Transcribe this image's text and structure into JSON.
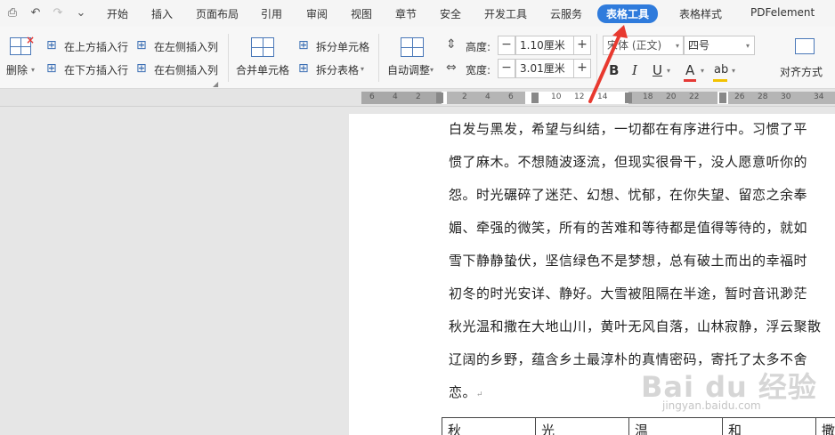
{
  "quick_access": {
    "items": [
      "preview-icon",
      "undo-icon",
      "redo-icon",
      "more-icon"
    ]
  },
  "menu": {
    "tabs": [
      "开始",
      "插入",
      "页面布局",
      "引用",
      "审阅",
      "视图",
      "章节",
      "安全",
      "开发工具",
      "云服务",
      "表格工具",
      "表格样式",
      "PDFelement"
    ],
    "active": "表格工具"
  },
  "ribbon": {
    "delete_label": "删除",
    "insert_above": "在上方插入行",
    "insert_below": "在下方插入行",
    "insert_left": "在左侧插入列",
    "insert_right": "在右侧插入列",
    "merge_cells": "合并单元格",
    "split_cells": "拆分单元格",
    "split_table": "拆分表格",
    "auto_fit": "自动调整",
    "height_label": "高度:",
    "height_value": "1.10厘米",
    "width_label": "宽度:",
    "width_value": "3.01厘米",
    "font_name": "宋体 (正文)",
    "font_size": "四号",
    "align_label": "对齐方式",
    "bold": "B",
    "italic": "I",
    "underline": "U",
    "font_color": "A",
    "highlight": "ab",
    "minus": "−",
    "plus": "+"
  },
  "ruler": {
    "ticks": [
      "6",
      "4",
      "2",
      "2",
      "4",
      "6",
      "10",
      "12",
      "14",
      "18",
      "20",
      "22",
      "26",
      "28",
      "30",
      "34"
    ]
  },
  "document": {
    "lines": [
      "白发与黑发，希望与纠结，一切都在有序进行中。习惯了平",
      "惯了麻木。不想随波逐流，但现实很骨干，没人愿意听你的",
      "怨。时光碾碎了迷茫、幻想、忧郁，在你失望、留恋之余奉",
      "媚、牵强的微笑，所有的苦难和等待都是值得等待的，就如",
      "雪下静静蛰伏，坚信绿色不是梦想，总有破土而出的幸福时",
      "初冬的时光安详、静好。大雪被阻隔在半途，暂时音讯渺茫",
      "秋光温和撒在大地山川，黄叶无风自落，山林寂静，浮云聚散",
      "辽阔的乡野，蕴含乡土最淳朴的真情密码，寄托了太多不舍",
      "恋。"
    ],
    "table_cells": [
      "秋",
      "光",
      "温",
      "和",
      "撒"
    ]
  },
  "watermark": {
    "brand": "Bai du 经验",
    "url": "jingyan.baidu.com"
  },
  "colors": {
    "accent": "#2f7bdc",
    "arrow": "#e8392f",
    "font_color_bar": "#e53935",
    "highlight_bar": "#f2c200",
    "underline_bar": "#2f7bdc"
  }
}
